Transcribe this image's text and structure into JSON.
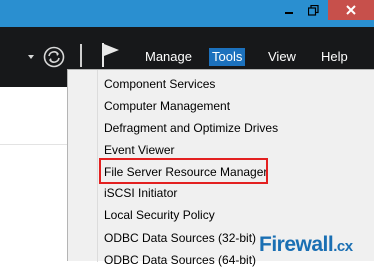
{
  "window_controls": {
    "minimize_icon": "minimize-icon",
    "maximize_icon": "restore-icon",
    "close_icon": "close-icon"
  },
  "toolbar": {
    "refresh_icon": "refresh-icon",
    "flag_icon": "notifications-flag-icon",
    "menu": [
      "Manage",
      "Tools",
      "View",
      "Help"
    ],
    "active_menu": "Tools"
  },
  "tools_menu": {
    "items": [
      "Component Services",
      "Computer Management",
      "Defragment and Optimize Drives",
      "Event Viewer",
      "File Server Resource Manager",
      "iSCSI Initiator",
      "Local Security Policy",
      "ODBC Data Sources (32-bit)",
      "ODBC Data Sources (64-bit)"
    ],
    "highlighted_item": "File Server Resource Manager"
  },
  "watermark": {
    "name": "Firewall",
    "tld": ".cx"
  },
  "colors": {
    "titlebar": "#2a8fd0",
    "toolbar": "#17181a",
    "active_menu": "#1c71bd",
    "close_button": "#c7504b",
    "highlight_border": "#e32020",
    "logo": "#1a6fb3"
  }
}
